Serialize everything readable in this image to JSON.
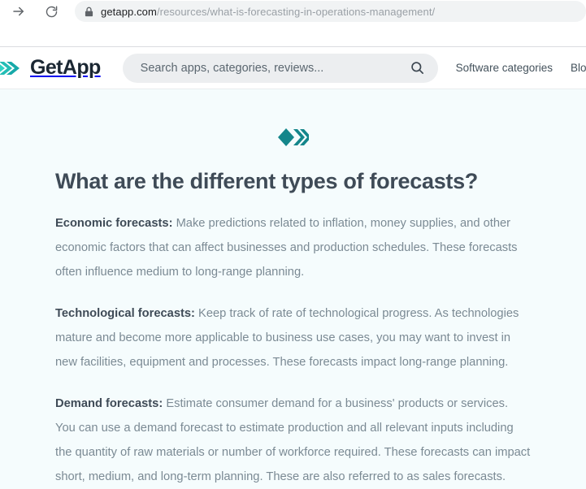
{
  "browser": {
    "forward_icon": "forward-arrow-icon",
    "reload_icon": "reload-icon",
    "lock_icon": "lock-icon",
    "url_domain": "getapp.com",
    "url_path": "/resources/what-is-forecasting-in-operations-management/"
  },
  "site_header": {
    "logo_icon": "getapp-chevrons-icon",
    "brand_name": "GetApp",
    "search": {
      "placeholder": "Search apps, categories, reviews...",
      "value": "",
      "icon": "search-icon"
    },
    "nav": [
      {
        "label": "Software categories"
      },
      {
        "label": "Blog & r"
      }
    ]
  },
  "main": {
    "divider_icon": "teal-diamond-chevrons-icon",
    "title": "What are the different types of forecasts?",
    "paragraphs": [
      {
        "term": "Economic forecasts:",
        "text": " Make predictions related to inflation, money supplies, and other economic factors that can affect businesses and production schedules. These forecasts often influence medium to long-range planning."
      },
      {
        "term": "Technological forecasts:",
        "text": " Keep track of rate of technological progress. As technologies mature and become more applicable to business use cases, you may want to invest in new facilities, equipment and processes. These forecasts impact long-range planning."
      },
      {
        "term": "Demand forecasts:",
        "text": " Estimate consumer demand for a business' products or services. You can use a demand forecast to estimate production and all relevant inputs including the quantity of raw materials or number of workforce required. These forecasts can impact short, medium, and long-term planning. These are also referred to as sales forecasts."
      }
    ]
  },
  "colors": {
    "brand_teal": "#1a8f8f",
    "logo_light_teal": "#2ed4c6",
    "page_bg": "#f5fcfd",
    "heading": "#3f4b57",
    "body_text": "#7b8a94"
  }
}
